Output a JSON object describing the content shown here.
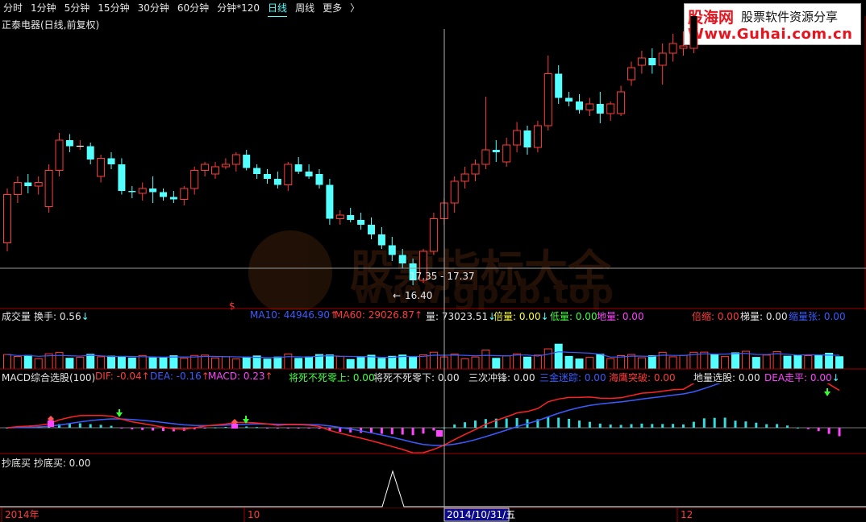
{
  "toolbar": {
    "items": [
      {
        "label": "分时",
        "active": false
      },
      {
        "label": "1分钟",
        "active": false
      },
      {
        "label": "5分钟",
        "active": false
      },
      {
        "label": "15分钟",
        "active": false
      },
      {
        "label": "30分钟",
        "active": false
      },
      {
        "label": "60分钟",
        "active": false
      },
      {
        "label": "分钟*120",
        "active": false
      },
      {
        "label": "日线",
        "active": true
      },
      {
        "label": "周线",
        "active": false
      },
      {
        "label": "更多",
        "active": false
      }
    ],
    "more_arrow": "〉"
  },
  "stock_title": "正泰电器(日线,前复权)",
  "logo": {
    "line1a": "股海网",
    "line1b": "股票软件资源分享",
    "line2": "Www.Guhai.com.cn"
  },
  "watermark": {
    "cn": "股票指标大全",
    "en": "www.gpzb.top"
  },
  "price_chart": {
    "range_label": "17.35 - 17.37",
    "low_label": "16.40",
    "low_arrow": "←",
    "signal_marker": "$",
    "colors": {
      "up": "#ff3b3b",
      "down": "#54ffff",
      "ma": "#ffffff"
    },
    "candles": [
      [
        17.05,
        17.5,
        16.98,
        17.45
      ],
      [
        17.45,
        17.6,
        17.38,
        17.55
      ],
      [
        17.55,
        17.62,
        17.46,
        17.52
      ],
      [
        17.52,
        17.6,
        17.45,
        17.55
      ],
      [
        17.35,
        17.7,
        17.3,
        17.65
      ],
      [
        17.65,
        17.96,
        17.6,
        17.9
      ],
      [
        17.9,
        17.95,
        17.8,
        17.85
      ],
      [
        17.85,
        17.9,
        17.82,
        17.85
      ],
      [
        17.85,
        17.88,
        17.7,
        17.74
      ],
      [
        17.6,
        17.78,
        17.55,
        17.75
      ],
      [
        17.75,
        17.8,
        17.66,
        17.7
      ],
      [
        17.7,
        17.75,
        17.45,
        17.48
      ],
      [
        17.48,
        17.52,
        17.42,
        17.47
      ],
      [
        17.46,
        17.55,
        17.4,
        17.5
      ],
      [
        17.5,
        17.6,
        17.38,
        17.47
      ],
      [
        17.47,
        17.5,
        17.4,
        17.43
      ],
      [
        17.43,
        17.48,
        17.38,
        17.41
      ],
      [
        17.41,
        17.52,
        17.36,
        17.5
      ],
      [
        17.5,
        17.68,
        17.45,
        17.65
      ],
      [
        17.65,
        17.72,
        17.6,
        17.7
      ],
      [
        17.62,
        17.72,
        17.58,
        17.68
      ],
      [
        17.68,
        17.75,
        17.66,
        17.7
      ],
      [
        17.7,
        17.8,
        17.64,
        17.78
      ],
      [
        17.78,
        17.82,
        17.65,
        17.67
      ],
      [
        17.67,
        17.7,
        17.58,
        17.62
      ],
      [
        17.62,
        17.66,
        17.54,
        17.58
      ],
      [
        17.58,
        17.64,
        17.5,
        17.53
      ],
      [
        17.53,
        17.72,
        17.48,
        17.7
      ],
      [
        17.7,
        17.76,
        17.62,
        17.64
      ],
      [
        17.64,
        17.7,
        17.58,
        17.6
      ],
      [
        17.62,
        17.66,
        17.5,
        17.53
      ],
      [
        17.53,
        17.58,
        17.2,
        17.25
      ],
      [
        17.25,
        17.32,
        17.2,
        17.28
      ],
      [
        17.28,
        17.34,
        17.22,
        17.24
      ],
      [
        17.24,
        17.3,
        17.16,
        17.2
      ],
      [
        17.2,
        17.26,
        17.08,
        17.12
      ],
      [
        17.12,
        17.18,
        17.0,
        17.03
      ],
      [
        17.03,
        17.1,
        16.9,
        16.95
      ],
      [
        16.95,
        17.0,
        16.84,
        16.88
      ],
      [
        16.88,
        16.92,
        16.7,
        16.74
      ],
      [
        16.74,
        17.0,
        16.72,
        16.98
      ],
      [
        16.98,
        17.3,
        16.95,
        17.25
      ],
      [
        17.25,
        17.42,
        17.2,
        17.38
      ],
      [
        17.38,
        17.6,
        17.3,
        17.56
      ],
      [
        17.56,
        17.68,
        17.5,
        17.62
      ],
      [
        17.62,
        17.74,
        17.56,
        17.7
      ],
      [
        17.7,
        18.26,
        17.66,
        17.82
      ],
      [
        17.82,
        17.9,
        17.72,
        17.8
      ],
      [
        17.72,
        17.92,
        17.68,
        17.86
      ],
      [
        17.86,
        18.05,
        17.8,
        17.98
      ],
      [
        17.98,
        18.02,
        17.78,
        17.84
      ],
      [
        17.84,
        18.06,
        17.8,
        18.02
      ],
      [
        18.02,
        18.6,
        17.98,
        18.45
      ],
      [
        18.45,
        18.52,
        18.2,
        18.25
      ],
      [
        18.25,
        18.3,
        18.18,
        18.22
      ],
      [
        18.22,
        18.28,
        18.12,
        18.15
      ],
      [
        18.15,
        18.25,
        18.1,
        18.2
      ],
      [
        18.2,
        18.3,
        18.04,
        18.12
      ],
      [
        18.12,
        18.22,
        18.06,
        18.2
      ],
      [
        18.12,
        18.35,
        18.1,
        18.3
      ],
      [
        18.4,
        18.55,
        18.35,
        18.5
      ],
      [
        18.52,
        18.64,
        18.45,
        18.58
      ],
      [
        18.58,
        18.66,
        18.45,
        18.52
      ],
      [
        18.52,
        18.7,
        18.36,
        18.62
      ],
      [
        18.62,
        18.78,
        18.55,
        18.7
      ],
      [
        18.66,
        18.8,
        18.6,
        18.68
      ],
      [
        18.66,
        19.32,
        18.62,
        19.22
      ],
      [
        19.22,
        19.72,
        19.15,
        19.6
      ],
      [
        19.6,
        19.66,
        19.4,
        19.45
      ],
      [
        19.42,
        19.6,
        19.28,
        19.56
      ],
      [
        19.56,
        19.58,
        19.1,
        19.18
      ],
      [
        19.18,
        19.52,
        19.06,
        19.48
      ],
      [
        19.48,
        19.56,
        19.34,
        19.46
      ],
      [
        19.4,
        19.52,
        19.26,
        19.44
      ],
      [
        19.44,
        19.78,
        19.38,
        19.7
      ],
      [
        19.7,
        19.78,
        19.5,
        19.54
      ],
      [
        19.54,
        19.58,
        19.38,
        19.42
      ],
      [
        19.42,
        19.5,
        19.3,
        19.47
      ],
      [
        19.47,
        19.56,
        19.26,
        19.32
      ],
      [
        19.32,
        19.4,
        19.06,
        19.12
      ],
      [
        19.12,
        19.2,
        18.96,
        19.02
      ]
    ]
  },
  "volume_pane": {
    "title": "成交量",
    "items": [
      {
        "label": "换手: 0.56",
        "color": "#e6e6e6",
        "arrow": "↓",
        "arrow_color": "#54ffff"
      },
      {
        "label": "MA10: 44946.90",
        "color": "#3a5cff",
        "arrow": "↑",
        "arrow_color": "#ff3b3b"
      },
      {
        "label": "MA60: 29026.87",
        "color": "#ff3b3b",
        "arrow": "↑",
        "arrow_color": "#ff3b3b"
      },
      {
        "label": "量: 73023.51",
        "color": "#e6e6e6",
        "arrow": "↓",
        "arrow_color": "#54ffff"
      },
      {
        "label": "倍量: 0.00",
        "color": "#ffff44",
        "arrow": "↓",
        "arrow_color": "#54ffff"
      },
      {
        "label": "低量: 0.00",
        "color": "#44ff44",
        "arrow": "",
        "arrow_color": ""
      },
      {
        "label": "地量: 0.00",
        "color": "#ff44ff",
        "arrow": "",
        "arrow_color": ""
      },
      {
        "label": "倍缩: 0.00",
        "color": "#ff3b3b",
        "arrow": "",
        "arrow_color": ""
      },
      {
        "label": "梯量: 0.00",
        "color": "#e6e6e6",
        "arrow": "",
        "arrow_color": ""
      },
      {
        "label": "缩量张: 0.00",
        "color": "#3a5cff",
        "arrow": "",
        "arrow_color": ""
      }
    ]
  },
  "macd_pane": {
    "items": [
      {
        "label": "MACD综合选股(100)",
        "color": "#e6e6e6",
        "arrow": "",
        "arrow_color": ""
      },
      {
        "label": "DIF: -0.04",
        "color": "#ff3b3b",
        "arrow": "↑",
        "arrow_color": "#ff3b3b"
      },
      {
        "label": "DEA: -0.16",
        "color": "#3a5cff",
        "arrow": "↑",
        "arrow_color": "#ff3b3b"
      },
      {
        "label": "MACD: 0.23",
        "color": "#ff44ff",
        "arrow": "↑",
        "arrow_color": "#ff3b3b"
      },
      {
        "label": "将死不死零上: 0.00",
        "color": "#44ff44",
        "arrow": "",
        "arrow_color": ""
      },
      {
        "label": "将死不死零下: 0.00",
        "color": "#e6e6e6",
        "arrow": "",
        "arrow_color": ""
      },
      {
        "label": "三次冲锋: 0.00",
        "color": "#e6e6e6",
        "arrow": "",
        "arrow_color": ""
      },
      {
        "label": "三金迷踪: 0.00",
        "color": "#3a5cff",
        "arrow": "",
        "arrow_color": ""
      },
      {
        "label": "海鹰突破: 0.00",
        "color": "#ff3b3b",
        "arrow": "",
        "arrow_color": ""
      },
      {
        "label": "地量选股: 0.00",
        "color": "#e6e6e6",
        "arrow": "",
        "arrow_color": ""
      },
      {
        "label": "DEA走平: 0.00",
        "color": "#ff44ff",
        "arrow": "↓",
        "arrow_color": "#54ffff"
      }
    ]
  },
  "bottom_pane": {
    "label": "抄底买  抄底买: 0.00"
  },
  "xaxis": {
    "year_label": "2014年",
    "oct_label": "10",
    "cursor_date": "2014/10/31/五",
    "dec_label": "12"
  }
}
